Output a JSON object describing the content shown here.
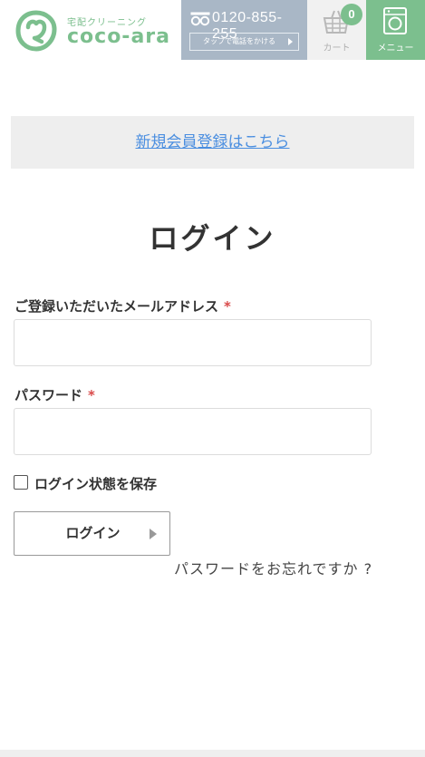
{
  "header": {
    "logo_subtitle": "宅配クリーニング",
    "logo_text": "coco-ara",
    "tel_number": "0120-855-255",
    "tel_button_label": "タップで電話をかける",
    "cart_count": "0",
    "cart_label": "カート",
    "menu_label": "メニュー"
  },
  "register": {
    "link_label": "新規会員登録はこちら"
  },
  "login": {
    "title": "ログイン",
    "email_label": "ご登録いただいたメールアドレス",
    "password_label": "パスワード",
    "required_mark": "*",
    "email_value": "",
    "password_value": "",
    "remember_label": "ログイン状態を保存",
    "remember_checked": false,
    "submit_label": "ログイン",
    "forgot_label": "パスワードをお忘れですか ?"
  },
  "colors": {
    "brand_green": "#7cbf8e",
    "tel_bg": "#a9b7c6",
    "link_blue": "#4a8ee0",
    "required_red": "#d94a4a"
  },
  "icons": {
    "logo": "coco-ara-logo-icon",
    "tel": "freedial-icon",
    "cart": "basket-icon",
    "menu": "washing-machine-icon",
    "submit_arrow": "triangle-right-icon"
  }
}
